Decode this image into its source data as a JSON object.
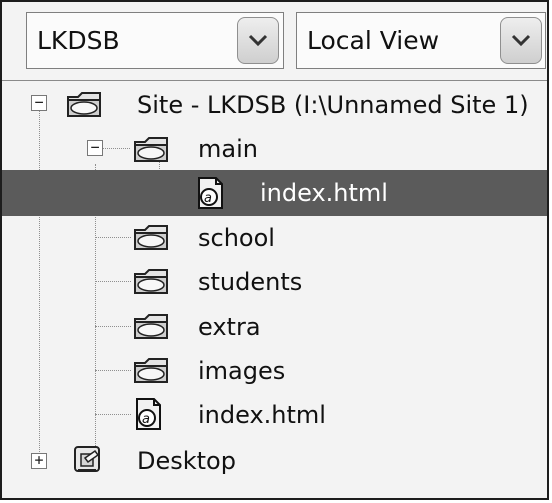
{
  "site_selector": {
    "selected": "LKDSB"
  },
  "view_selector": {
    "selected": "Local View"
  },
  "tree": {
    "root": {
      "label": "Site - LKDSB (I:\\Unnamed Site 1)",
      "expander": "−"
    },
    "main": {
      "label": "main",
      "expander": "−"
    },
    "main_index": {
      "label": "index.html"
    },
    "school": {
      "label": "school"
    },
    "students": {
      "label": "students"
    },
    "extra": {
      "label": "extra"
    },
    "images": {
      "label": "images"
    },
    "root_index": {
      "label": "index.html"
    },
    "desktop": {
      "label": "Desktop",
      "expander": "+"
    }
  }
}
